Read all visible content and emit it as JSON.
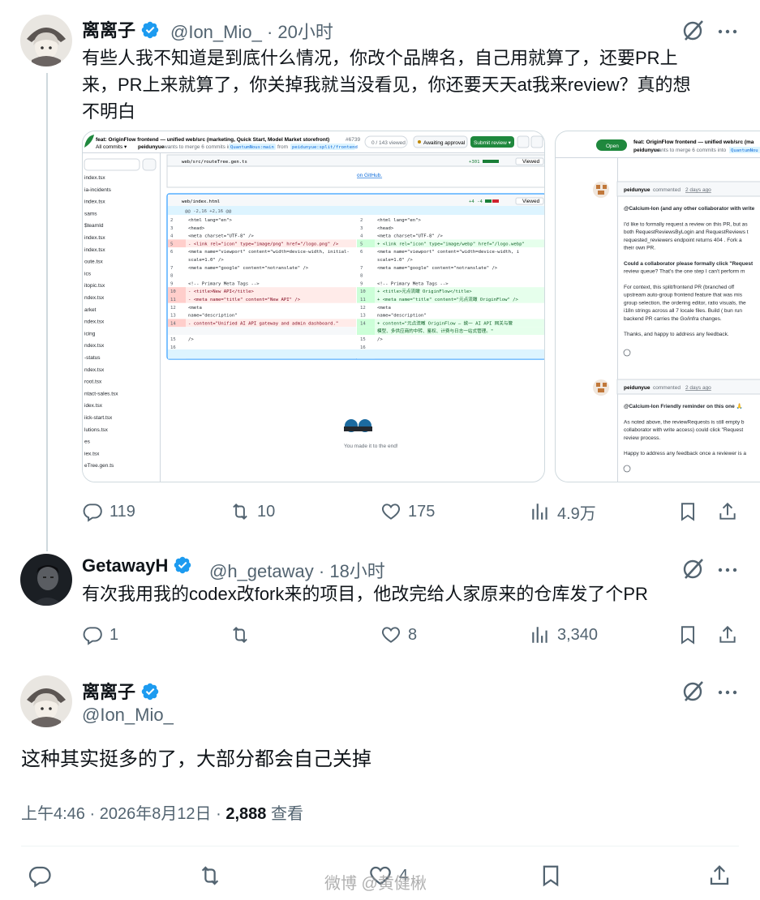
{
  "tweet1": {
    "name": "离离子",
    "handle": "@Ion_Mio_",
    "time": "20小时",
    "text_line1": "有些人我不知道是到底什么情况，你改个品牌名，自己用就算了，还要PR上",
    "text_line2": "来，PR上来就算了，你关掉我就当没看见，你还要天天at我来review？真的想",
    "text_line3": "不明白",
    "replies": "119",
    "retweets": "10",
    "likes": "175",
    "views": "4.9万",
    "media": {
      "left": {
        "pr_title": "feat: OriginFlow frontend — unified web/src (marketing, Quick Start, Model Market storefront)",
        "pr_number": "#6739",
        "all_commits": "All commits ▾",
        "author_line_user": "peidunyue",
        "author_line_mid": "wants to merge 6 commits into",
        "author_line_base": "QuantumNous:main",
        "author_line_from": "from",
        "author_line_head": "peidunyue:split/frontend",
        "viewed_count": "0 / 143 viewed",
        "awaiting": "Awaiting approval",
        "submit": "Submit review ▾",
        "file1": "web/src/routeTree.gen.ts",
        "file1_stats": "+301",
        "file1_link": "on GitHub.",
        "file2": "web/index.html",
        "file2_stats": "+4 -4",
        "viewed": "Viewed",
        "hunk": "@@ -2,16 +2,16 @@",
        "end_text": "You made it to the end!",
        "sidebar_files": [
          "index.tsx",
          "ia-incidents",
          "index.tsx",
          "sams",
          "$teamId",
          "index.tsx",
          "index.tsx",
          "oute.tsx",
          "ics",
          "itopic.tsx",
          "ndex.tsx",
          "arket",
          "ndex.tsx",
          "icing",
          "ndex.tsx",
          "-status",
          "ndex.tsx",
          "root.tsx",
          "ntact-sales.tsx",
          "idex.tsx",
          "iick-start.tsx",
          "lutions.tsx",
          "es",
          "iex.tsx",
          "eTree.gen.ts"
        ],
        "diff_left": [
          {
            "n": "2",
            "code": "<html lang=\"en\">",
            "type": "ctx"
          },
          {
            "n": "3",
            "code": "  <head>",
            "type": "ctx"
          },
          {
            "n": "4",
            "code": "    <meta charset=\"UTF-8\" />",
            "type": "ctx"
          },
          {
            "n": "5",
            "code": "-   <link rel=\"icon\" type=\"image/png\" href=\"/logo.png\" />",
            "type": "del"
          },
          {
            "n": "6",
            "code": "    <meta name=\"viewport\" content=\"width=device-width, initial-",
            "type": "ctx"
          },
          {
            "n": "",
            "code": "scale=1.0\" />",
            "type": "ctx"
          },
          {
            "n": "7",
            "code": "    <meta name=\"google\" content=\"notranslate\" />",
            "type": "ctx"
          },
          {
            "n": "8",
            "code": "",
            "type": "ctx"
          },
          {
            "n": "9",
            "code": "    <!-- Primary Meta Tags -->",
            "type": "ctx"
          },
          {
            "n": "10",
            "code": "-   <title>New API</title>",
            "type": "del"
          },
          {
            "n": "11",
            "code": "-   <meta name=\"title\" content=\"New API\" />",
            "type": "del"
          },
          {
            "n": "12",
            "code": "    <meta",
            "type": "ctx"
          },
          {
            "n": "13",
            "code": "      name=\"description\"",
            "type": "ctx"
          },
          {
            "n": "14",
            "code": "-     content=\"Unified AI API gateway and admin dashboard.\"",
            "type": "del"
          },
          {
            "n": "15",
            "code": "    />",
            "type": "ctx"
          },
          {
            "n": "16",
            "code": "",
            "type": "ctx"
          },
          {
            "n": "17",
            "code": "    <meta name=\"theme-color\" content=\"#fff\" />",
            "type": "ctx"
          }
        ],
        "diff_right": [
          {
            "n": "2",
            "code": "<html lang=\"en\">",
            "type": "ctx"
          },
          {
            "n": "3",
            "code": "  <head>",
            "type": "ctx"
          },
          {
            "n": "4",
            "code": "    <meta charset=\"UTF-8\" />",
            "type": "ctx"
          },
          {
            "n": "5",
            "code": "+   <link rel=\"icon\" type=\"image/webp\" href=\"/logo.webp\"",
            "type": "add"
          },
          {
            "n": "6",
            "code": "    <meta name=\"viewport\" content=\"width=device-width, i",
            "type": "ctx"
          },
          {
            "n": "",
            "code": "scale=1.0\" />",
            "type": "ctx"
          },
          {
            "n": "7",
            "code": "    <meta name=\"google\" content=\"notranslate\" />",
            "type": "ctx"
          },
          {
            "n": "8",
            "code": "",
            "type": "ctx"
          },
          {
            "n": "9",
            "code": "    <!-- Primary Meta Tags -->",
            "type": "ctx"
          },
          {
            "n": "10",
            "code": "+   <title>元点流瞰 OriginFlow</title>",
            "type": "add"
          },
          {
            "n": "11",
            "code": "+   <meta name=\"title\" content=\"元点流瞰 OriginFlow\" />",
            "type": "add"
          },
          {
            "n": "12",
            "code": "    <meta",
            "type": "ctx"
          },
          {
            "n": "13",
            "code": "      name=\"description\"",
            "type": "ctx"
          },
          {
            "n": "14",
            "code": "+     content=\"元点流瞰 OriginFlow — 统一 AI API 网关与管",
            "type": "add"
          },
          {
            "n": "",
            "code": "模型、多供应商的中转、鉴权、计费与日志一站式管理。\"",
            "type": "add"
          },
          {
            "n": "15",
            "code": "    />",
            "type": "ctx"
          },
          {
            "n": "16",
            "code": "",
            "type": "ctx"
          },
          {
            "n": "17",
            "code": "    <meta name=\"theme-color\" content=\"#fff\" />",
            "type": "ctx"
          }
        ]
      },
      "right": {
        "open_badge": "Open",
        "pr_title": "feat: OriginFlow frontend — unified web/src (ma",
        "sub_user": "peidunyue",
        "sub_text": "wants to merge 6 commits into",
        "sub_base": "QuantumNou",
        "c1_user": "peidunyue",
        "c1_meta": "commented",
        "c1_time": "2 days ago",
        "c1_lines": [
          "@Calcium-Ion (and any other collaborator with write",
          "",
          "I'd like to formally request a review on this PR, but as",
          "both  RequestReviewsByLogin  and  RequestReviews  t",
          " requested_reviewers  endpoint returns  404 . Fork a",
          "their own PR.",
          "",
          "Could a collaborator please formally click \"Request",
          "review queue? That's the one step I can't perform m",
          "",
          "For context, this  split/frontend  PR (branched off",
          "upstream auto-group frontend feature that was mis",
          "group selection, the ordering editor, ratio visuals, the",
          "i18n strings across all 7 locale files. Build ( bun run",
          "backend PR carries the Go/infra changes.",
          "",
          "Thanks, and happy to address any feedback."
        ],
        "c2_user": "peidunyue",
        "c2_meta": "commented",
        "c2_time": "2 days ago",
        "c2_lines": [
          "@Calcium-Ion Friendly reminder on this one 🙏",
          "",
          "As noted above, the  reviewRequests  is still empty b",
          "collaborator with write access) could click \"Request",
          "review process.",
          "",
          "Happy to address any feedback once a reviewer is a"
        ]
      }
    }
  },
  "tweet2": {
    "name": "GetawayH",
    "handle": "@h_getaway",
    "time": "18小时",
    "text": "有次我用我的codex改fork来的项目，他改完给人家原来的仓库发了个PR",
    "replies": "1",
    "retweets": "",
    "likes": "8",
    "views": "3,340"
  },
  "main_tweet": {
    "name": "离离子",
    "handle": "@Ion_Mio_",
    "text": "这种其实挺多的了，大部分都会自己关掉",
    "time": "上午4:46 · 2026年8月12日",
    "views_num": "2,888",
    "views_label": "查看",
    "likes": "4"
  },
  "watermark": "微博 @黄健楸",
  "colors": {
    "verified": "#1d9bf0",
    "text_secondary": "#536471",
    "diff_del_bg": "#ffebe9",
    "diff_add_bg": "#e6ffec",
    "github_green": "#1f883d"
  },
  "icons": [
    "verified-icon",
    "grok-icon",
    "more-icon",
    "reply-icon",
    "retweet-icon",
    "like-icon",
    "views-icon",
    "bookmark-icon",
    "share-icon"
  ]
}
